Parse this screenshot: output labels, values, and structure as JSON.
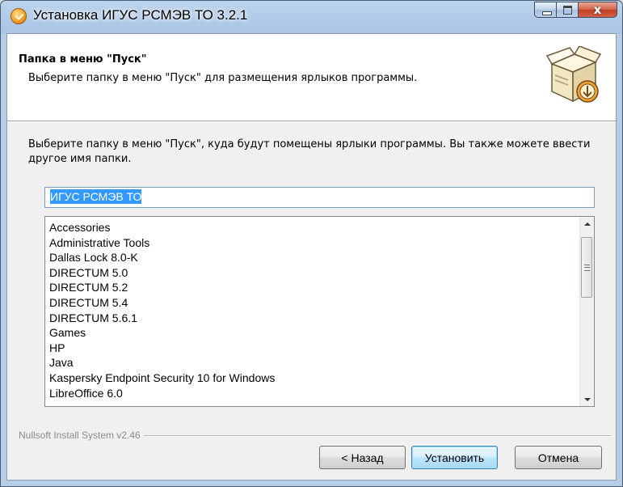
{
  "window": {
    "title": "Установка ИГУС РСМЭВ ТО 3.2.1",
    "close_glyph": "x"
  },
  "header": {
    "title": "Папка в меню \"Пуск\"",
    "subtitle": "Выберите папку в меню \"Пуск\" для размещения ярлыков программы."
  },
  "body": {
    "intro": "Выберите папку в меню \"Пуск\", куда будут помещены ярлыки программы. Вы также можете ввести другое имя папки.",
    "folder_value": "ИГУС РСМЭВ ТО",
    "folders": [
      "Accessories",
      "Administrative Tools",
      "Dallas Lock 8.0-K",
      "DIRECTUM 5.0",
      "DIRECTUM 5.2",
      "DIRECTUM 5.4",
      "DIRECTUM 5.6.1",
      "Games",
      "HP",
      "Java",
      "Kaspersky Endpoint Security 10 for Windows",
      "LibreOffice 6.0"
    ]
  },
  "footer": {
    "branding": "Nullsoft Install System v2.46",
    "back_label": "< Назад",
    "install_label": "Установить",
    "cancel_label": "Отмена"
  },
  "icons": {
    "title": "installer-app-icon",
    "header": "install-box-icon",
    "scroll_up": "scroll-up-arrow-icon",
    "scroll_down": "scroll-down-arrow-icon"
  }
}
